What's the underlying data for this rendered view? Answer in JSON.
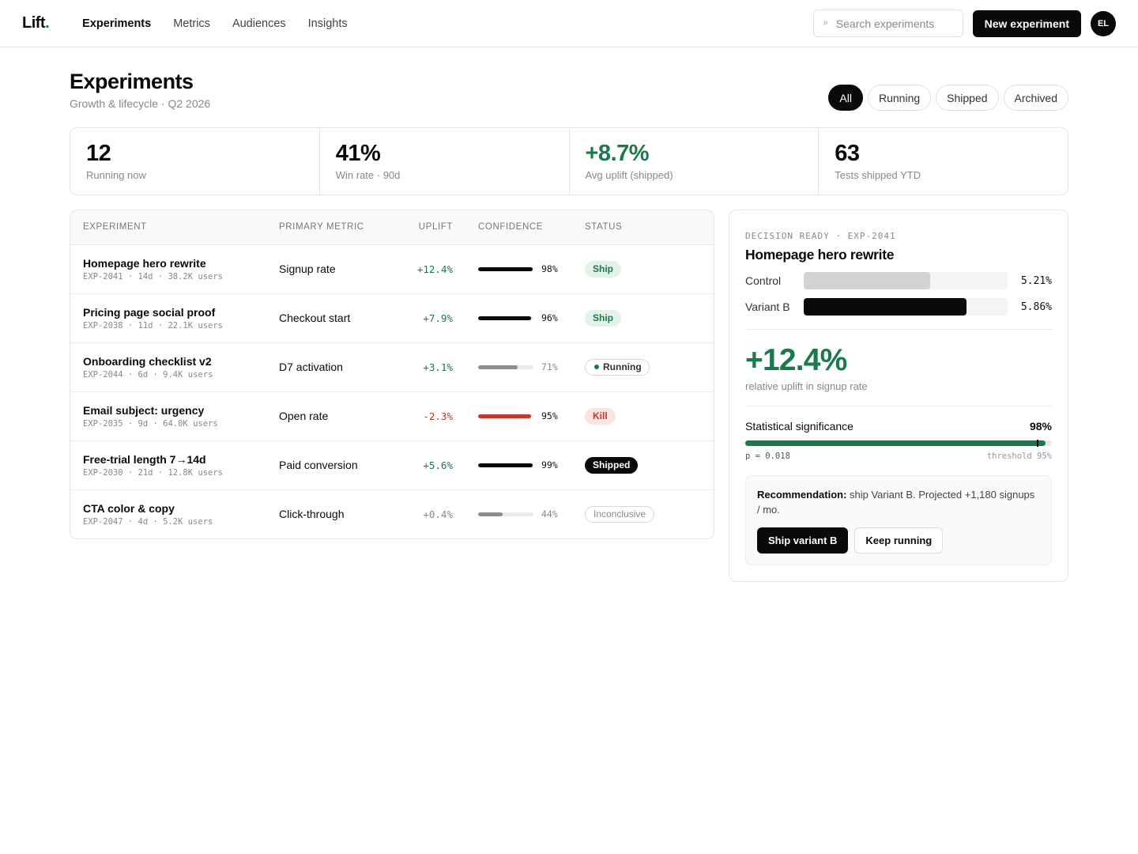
{
  "app": {
    "logo_text": "Lift",
    "logo_dot": ".",
    "nav": [
      "Experiments",
      "Metrics",
      "Audiences",
      "Insights"
    ],
    "search_icon": "⌕",
    "search_placeholder": "Search experiments",
    "new_button": "New experiment",
    "avatar_initials": "EL"
  },
  "page": {
    "title": "Experiments",
    "subtitle": "Growth & lifecycle · Q2 2026",
    "filters": [
      "All",
      "Running",
      "Shipped",
      "Archived"
    ],
    "active_filter": "All"
  },
  "stats": [
    {
      "value": "12",
      "label": "Running now"
    },
    {
      "value": "41%",
      "label": "Win rate · 90d"
    },
    {
      "value": "+8.7%",
      "label": "Avg uplift (shipped)"
    },
    {
      "value": "63",
      "label": "Tests shipped YTD"
    }
  ],
  "table": {
    "headers": [
      "Experiment",
      "Primary metric",
      "Uplift",
      "Confidence",
      "Status"
    ],
    "rows": [
      {
        "name": "Homepage hero rewrite",
        "meta": "EXP-2041 · 14d · 38.2K users",
        "metric": "Signup rate",
        "uplift": "+12.4%",
        "confidence": "98%",
        "status": "Ship"
      },
      {
        "name": "Pricing page social proof",
        "meta": "EXP-2038 · 11d · 22.1K users",
        "metric": "Checkout start",
        "uplift": "+7.9%",
        "confidence": "96%",
        "status": "Ship"
      },
      {
        "name": "Onboarding checklist v2",
        "meta": "EXP-2044 · 6d · 9.4K users",
        "metric": "D7 activation",
        "uplift": "+3.1%",
        "confidence": "71%",
        "status": "Running"
      },
      {
        "name": "Email subject: urgency",
        "meta": "EXP-2035 · 9d · 64.0K users",
        "metric": "Open rate",
        "uplift": "-2.3%",
        "confidence": "95%",
        "status": "Kill"
      },
      {
        "name": "Free-trial length 7→14d",
        "meta": "EXP-2030 · 21d · 12.8K users",
        "metric": "Paid conversion",
        "uplift": "+5.6%",
        "confidence": "99%",
        "status": "Shipped"
      },
      {
        "name": "CTA color & copy",
        "meta": "EXP-2047 · 4d · 5.2K users",
        "metric": "Click-through",
        "uplift": "+0.4%",
        "confidence": "44%",
        "status": "Inconclusive"
      }
    ]
  },
  "detail": {
    "eyebrow": "Decision ready · EXP-2041",
    "title": "Homepage hero rewrite",
    "variants": [
      {
        "name": "Control",
        "value": "5.21%"
      },
      {
        "name": "Variant B",
        "value": "5.86%"
      }
    ],
    "uplift": "+12.4%",
    "uplift_caption": "relative uplift in signup rate",
    "significance_label": "Statistical significance",
    "significance": "98%",
    "p_value": "p = 0.018",
    "threshold": "threshold 95%",
    "reco_bold": "Recommendation:",
    "reco_text": " ship Variant B. Projected +1,180 signups / mo.",
    "ship_button": "Ship variant B",
    "keep_button": "Keep running"
  },
  "colors": {
    "accent_green": "#1a7a4c",
    "negative_red": "#c0392b",
    "ink": "#0a0a0a"
  }
}
